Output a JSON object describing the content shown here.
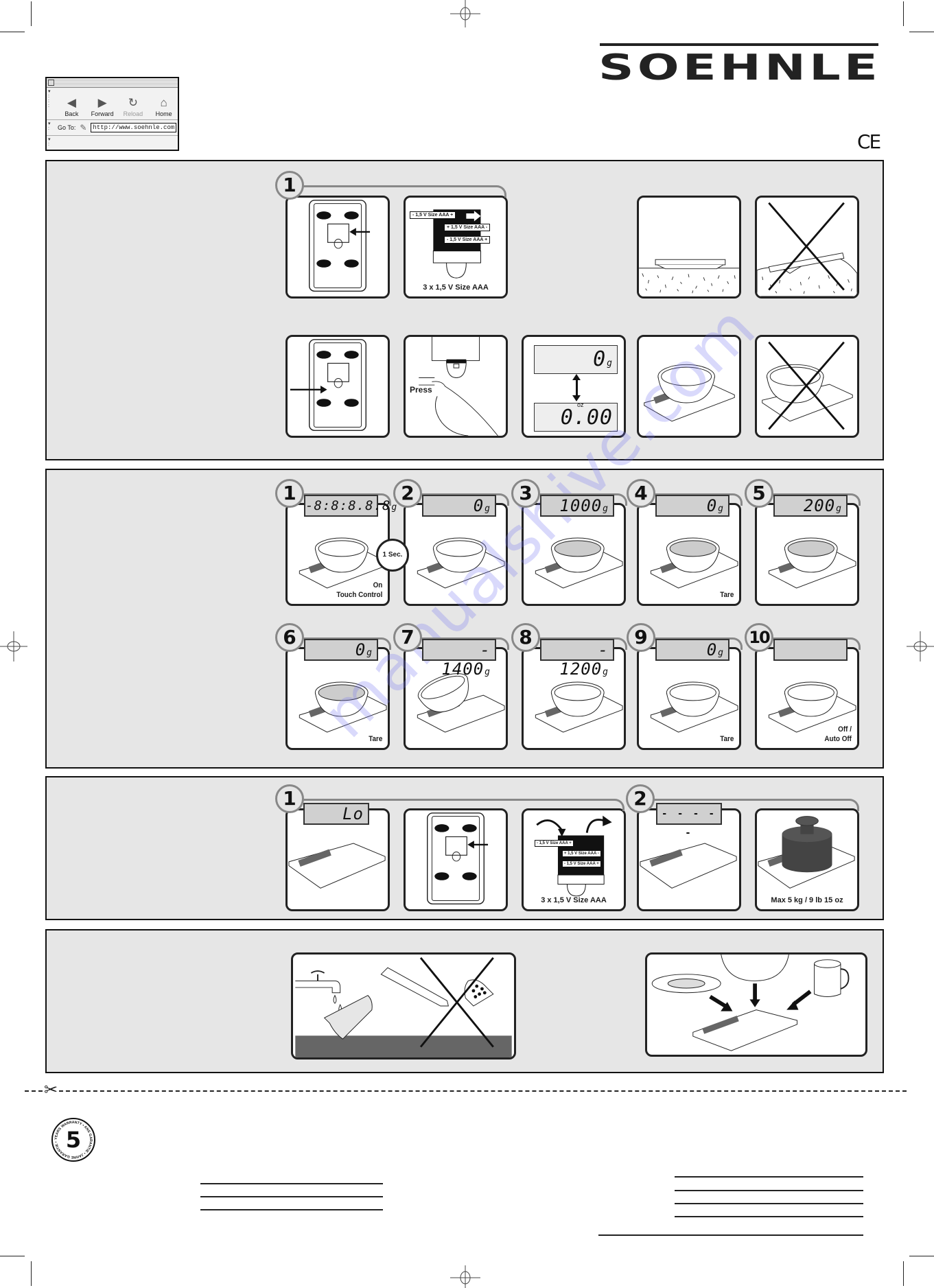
{
  "browser": {
    "buttons": [
      {
        "label": "Back",
        "icon": "back-arrow-icon",
        "enabled": true
      },
      {
        "label": "Forward",
        "icon": "forward-arrow-icon",
        "enabled": true
      },
      {
        "label": "Reload",
        "icon": "reload-icon",
        "enabled": false
      },
      {
        "label": "Home",
        "icon": "home-icon",
        "enabled": true
      }
    ],
    "goto_label": "Go To:",
    "url": "http://www.soehnle.com"
  },
  "brand": {
    "logo": "SOEHNLE",
    "ce_mark": "CE"
  },
  "section_setup": {
    "step_numbers": [
      "1"
    ],
    "battery_labels": [
      "- 1,5 V Size AAA +",
      "+ 1,5 V Size AAA -",
      "- 1,5 V Size AAA +"
    ],
    "battery_caption": "3 x 1,5 V Size AAA",
    "press_label": "Press",
    "display_g": {
      "value": "0",
      "unit": "g"
    },
    "display_oz": {
      "value": "0.00",
      "unit": "oz"
    },
    "surface_ok": "flat-surface",
    "surface_bad": "uneven-surface"
  },
  "section_weighing": {
    "steps": [
      {
        "num": "1",
        "display": "-8:8:8.8.8",
        "unit": "g",
        "caption": "On\nTouch Control",
        "timer": "1 Sec."
      },
      {
        "num": "2",
        "display": "0",
        "unit": "g",
        "caption": ""
      },
      {
        "num": "3",
        "display": "1000",
        "unit": "g",
        "caption": ""
      },
      {
        "num": "4",
        "display": "0",
        "unit": "g",
        "caption": "Tare"
      },
      {
        "num": "5",
        "display": "200",
        "unit": "g",
        "caption": ""
      },
      {
        "num": "6",
        "display": "0",
        "unit": "g",
        "caption": "Tare"
      },
      {
        "num": "7",
        "display": "- 1400",
        "unit": "g",
        "caption": ""
      },
      {
        "num": "8",
        "display": "- 1200",
        "unit": "g",
        "caption": ""
      },
      {
        "num": "9",
        "display": "0",
        "unit": "g",
        "caption": "Tare"
      },
      {
        "num": "10",
        "display": "",
        "unit": "",
        "caption": "Off /\nAuto Off"
      }
    ]
  },
  "section_battery": {
    "step_numbers": [
      "1",
      "2"
    ],
    "lo_display": "Lo",
    "battery_labels": [
      "- 1,5 V Size AAA +",
      "+ 1,5 V Size AAA -",
      "- 1,5 V Size AAA +"
    ],
    "battery_caption": "3 x 1,5 V Size AAA",
    "overload_display": "- - - - -",
    "max_caption": "Max 5 kg / 9 lb 15 oz"
  },
  "section_care": {
    "clean_ok": "damp-cloth",
    "clean_bad": "no-solvents-no-abrasives",
    "containers": "plate-bowl-mug-on-scale"
  },
  "warranty": {
    "years": "5",
    "ring_text": "YEARS WARRANTY • ANS GARANTIE • JAHRE GARANTIE •"
  },
  "watermark": "manualshive.com"
}
